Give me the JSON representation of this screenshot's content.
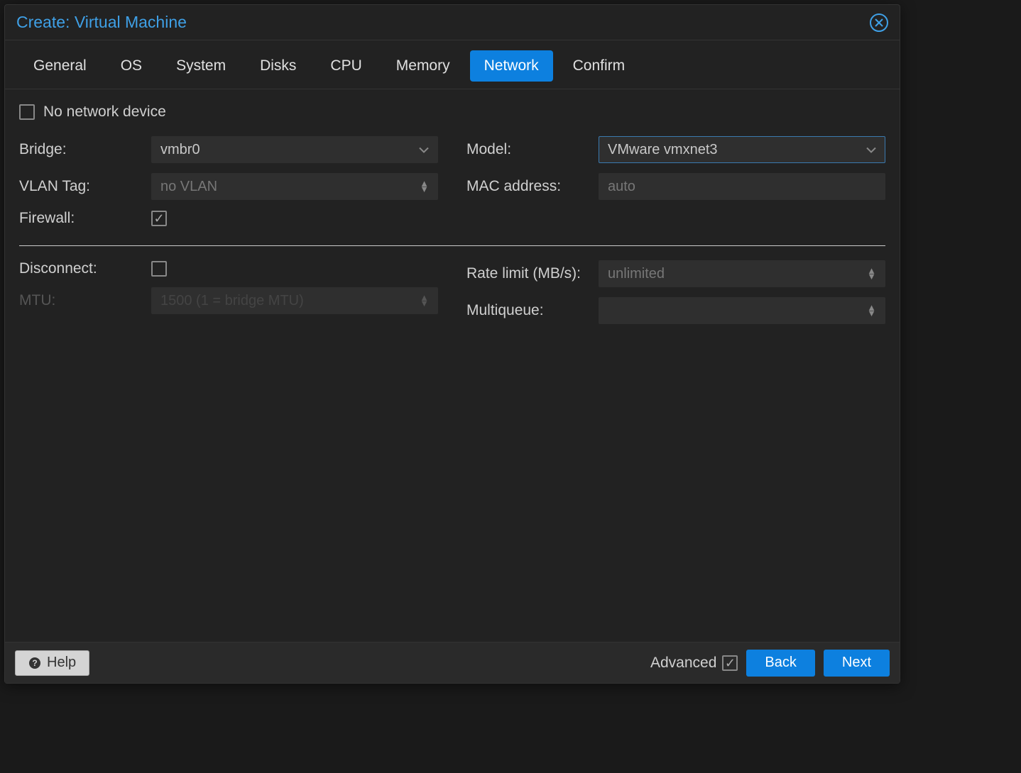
{
  "dialog": {
    "title": "Create: Virtual Machine"
  },
  "tabs": [
    {
      "label": "General"
    },
    {
      "label": "OS"
    },
    {
      "label": "System"
    },
    {
      "label": "Disks"
    },
    {
      "label": "CPU"
    },
    {
      "label": "Memory"
    },
    {
      "label": "Network",
      "active": true
    },
    {
      "label": "Confirm"
    }
  ],
  "network": {
    "no_device_label": "No network device",
    "no_device_checked": false,
    "bridge_label": "Bridge:",
    "bridge_value": "vmbr0",
    "vlan_label": "VLAN Tag:",
    "vlan_placeholder": "no VLAN",
    "firewall_label": "Firewall:",
    "firewall_checked": true,
    "model_label": "Model:",
    "model_value": "VMware vmxnet3",
    "mac_label": "MAC address:",
    "mac_placeholder": "auto",
    "disconnect_label": "Disconnect:",
    "disconnect_checked": false,
    "mtu_label": "MTU:",
    "mtu_placeholder": "1500 (1 = bridge MTU)",
    "ratelimit_label": "Rate limit (MB/s):",
    "ratelimit_placeholder": "unlimited",
    "multiqueue_label": "Multiqueue:"
  },
  "footer": {
    "help": "Help",
    "advanced": "Advanced",
    "advanced_checked": true,
    "back": "Back",
    "next": "Next"
  }
}
